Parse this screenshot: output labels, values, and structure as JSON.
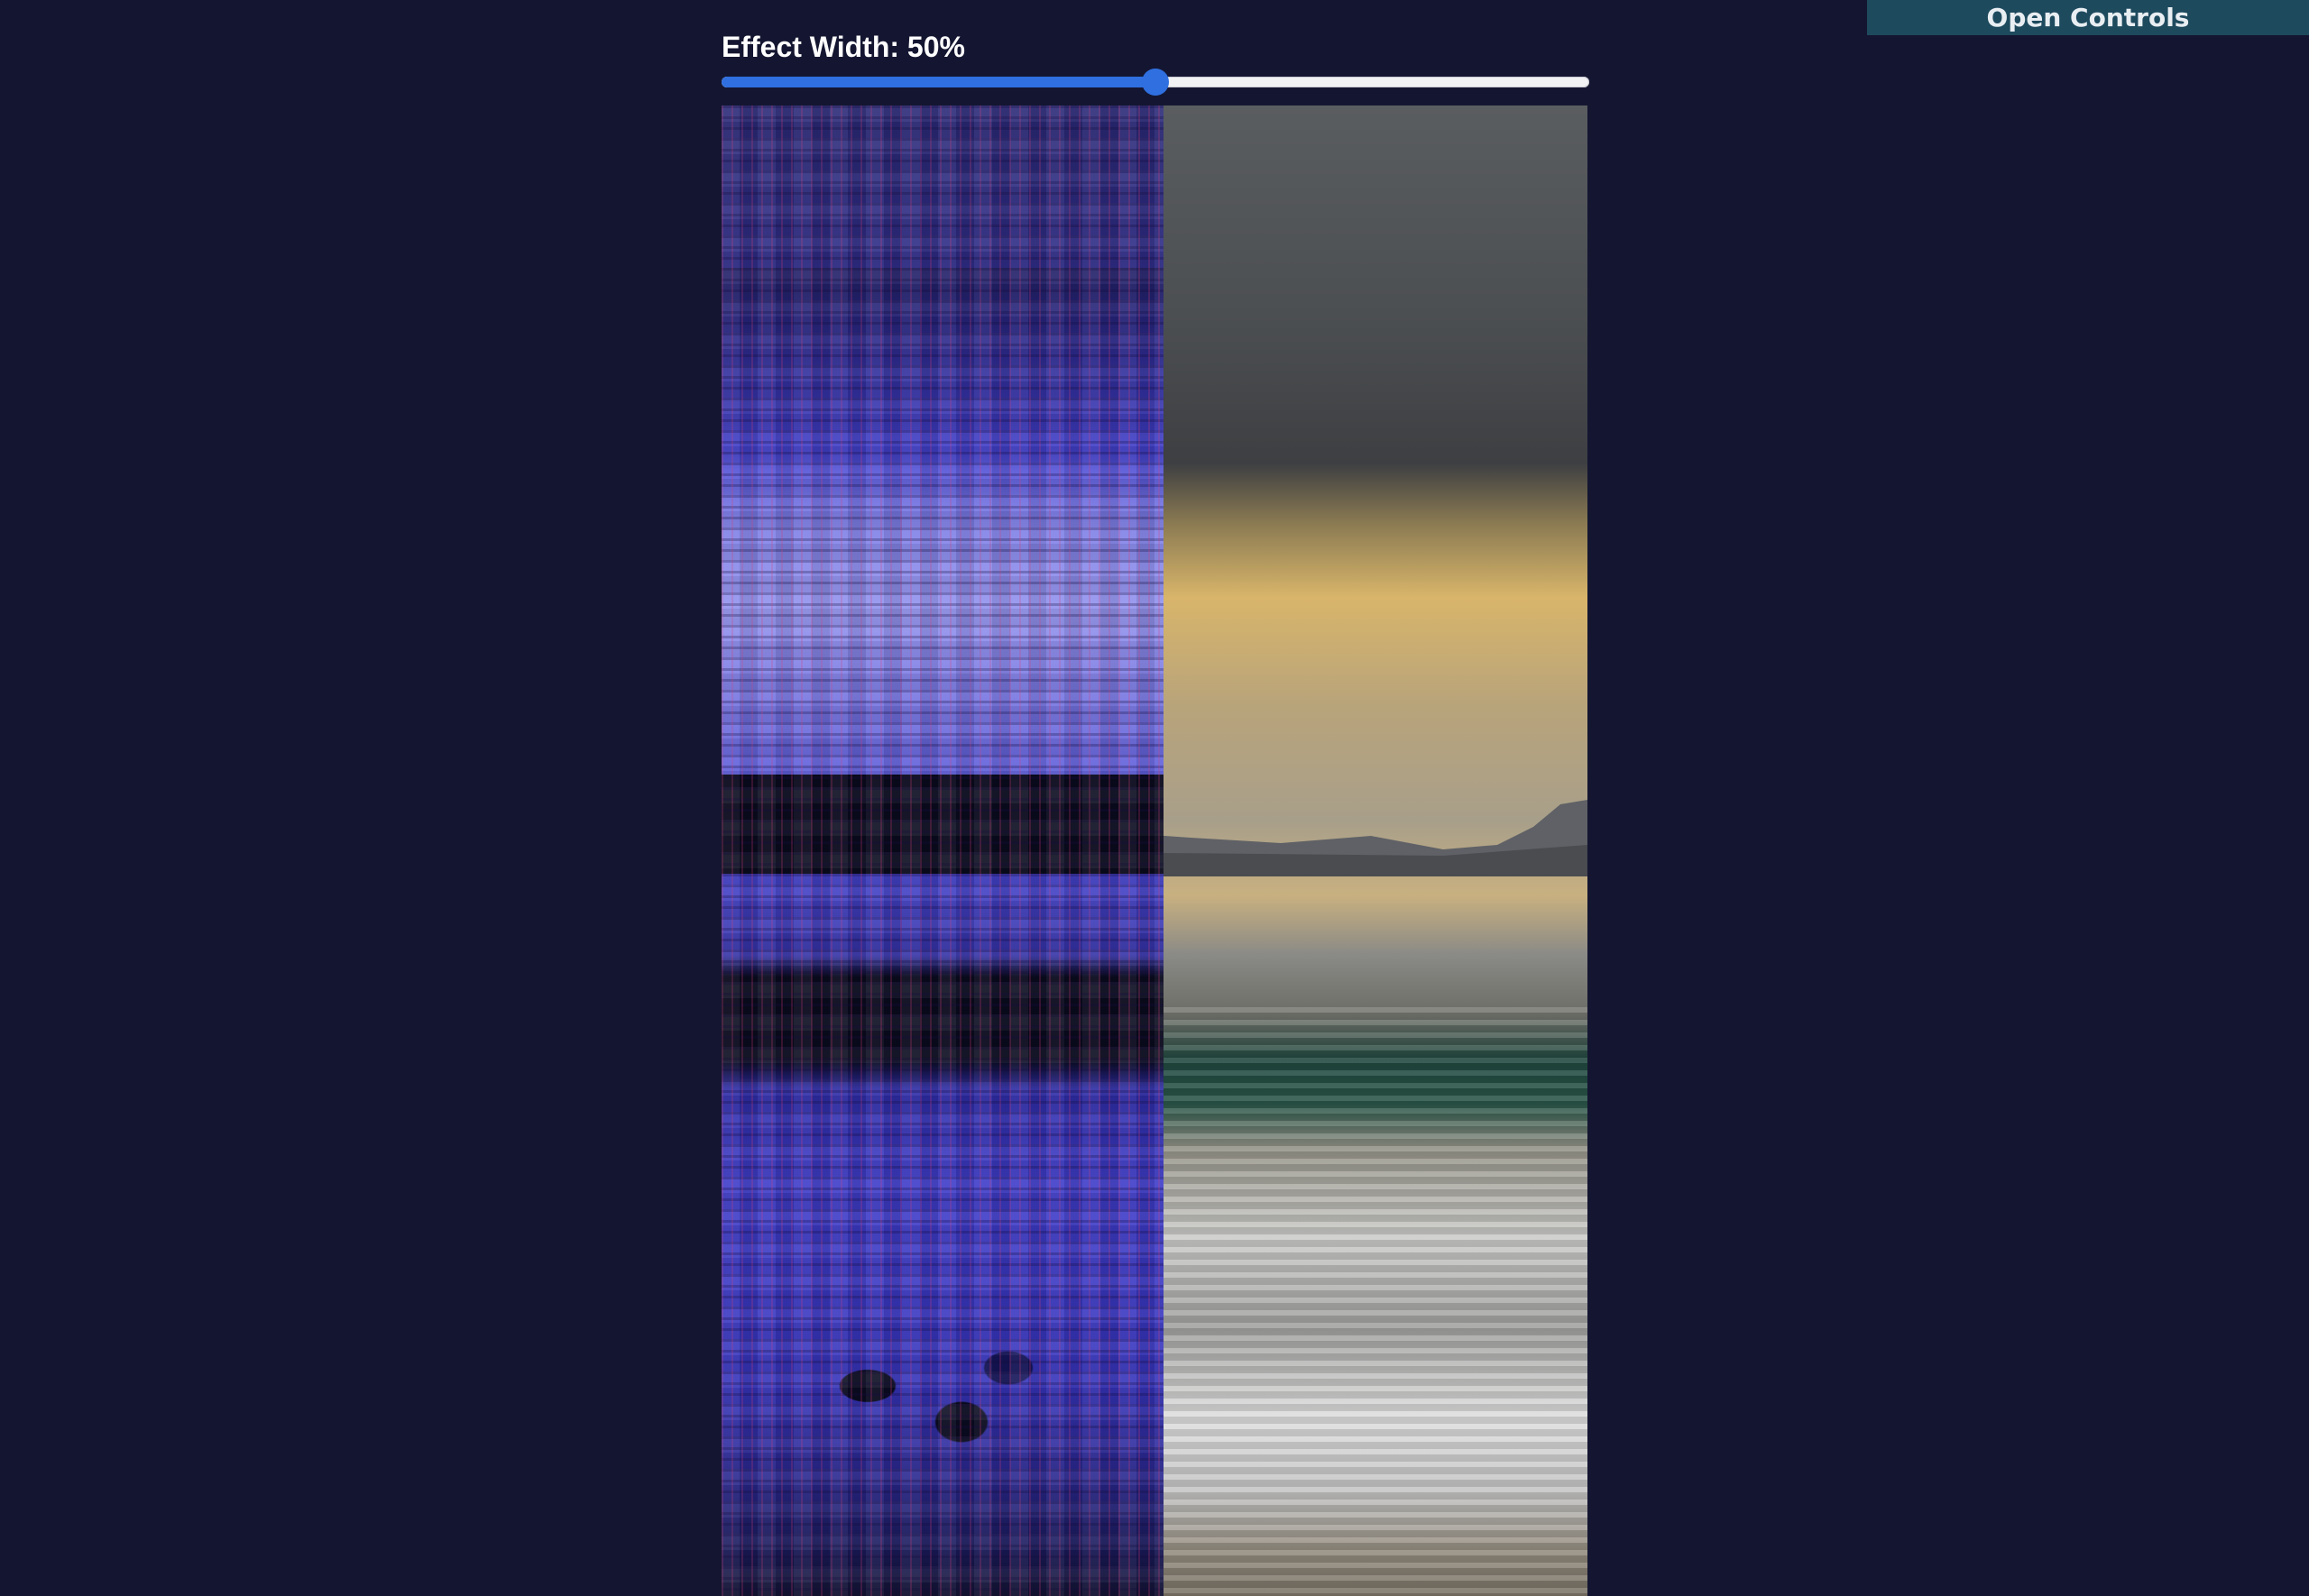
{
  "header": {
    "open_controls_label": "Open Controls"
  },
  "effect_slider": {
    "label": "Effect Width: 50%",
    "value_percent": 50
  },
  "colors": {
    "background": "#141631",
    "accent": "#2f6fe0",
    "controls_button": "#1e4a5e",
    "ascii_tint": "#4240cf",
    "glyph_color": "#dc3c78"
  },
  "video": {
    "left_panel": "ascii-effect",
    "right_panel": "original-beach-footage"
  }
}
